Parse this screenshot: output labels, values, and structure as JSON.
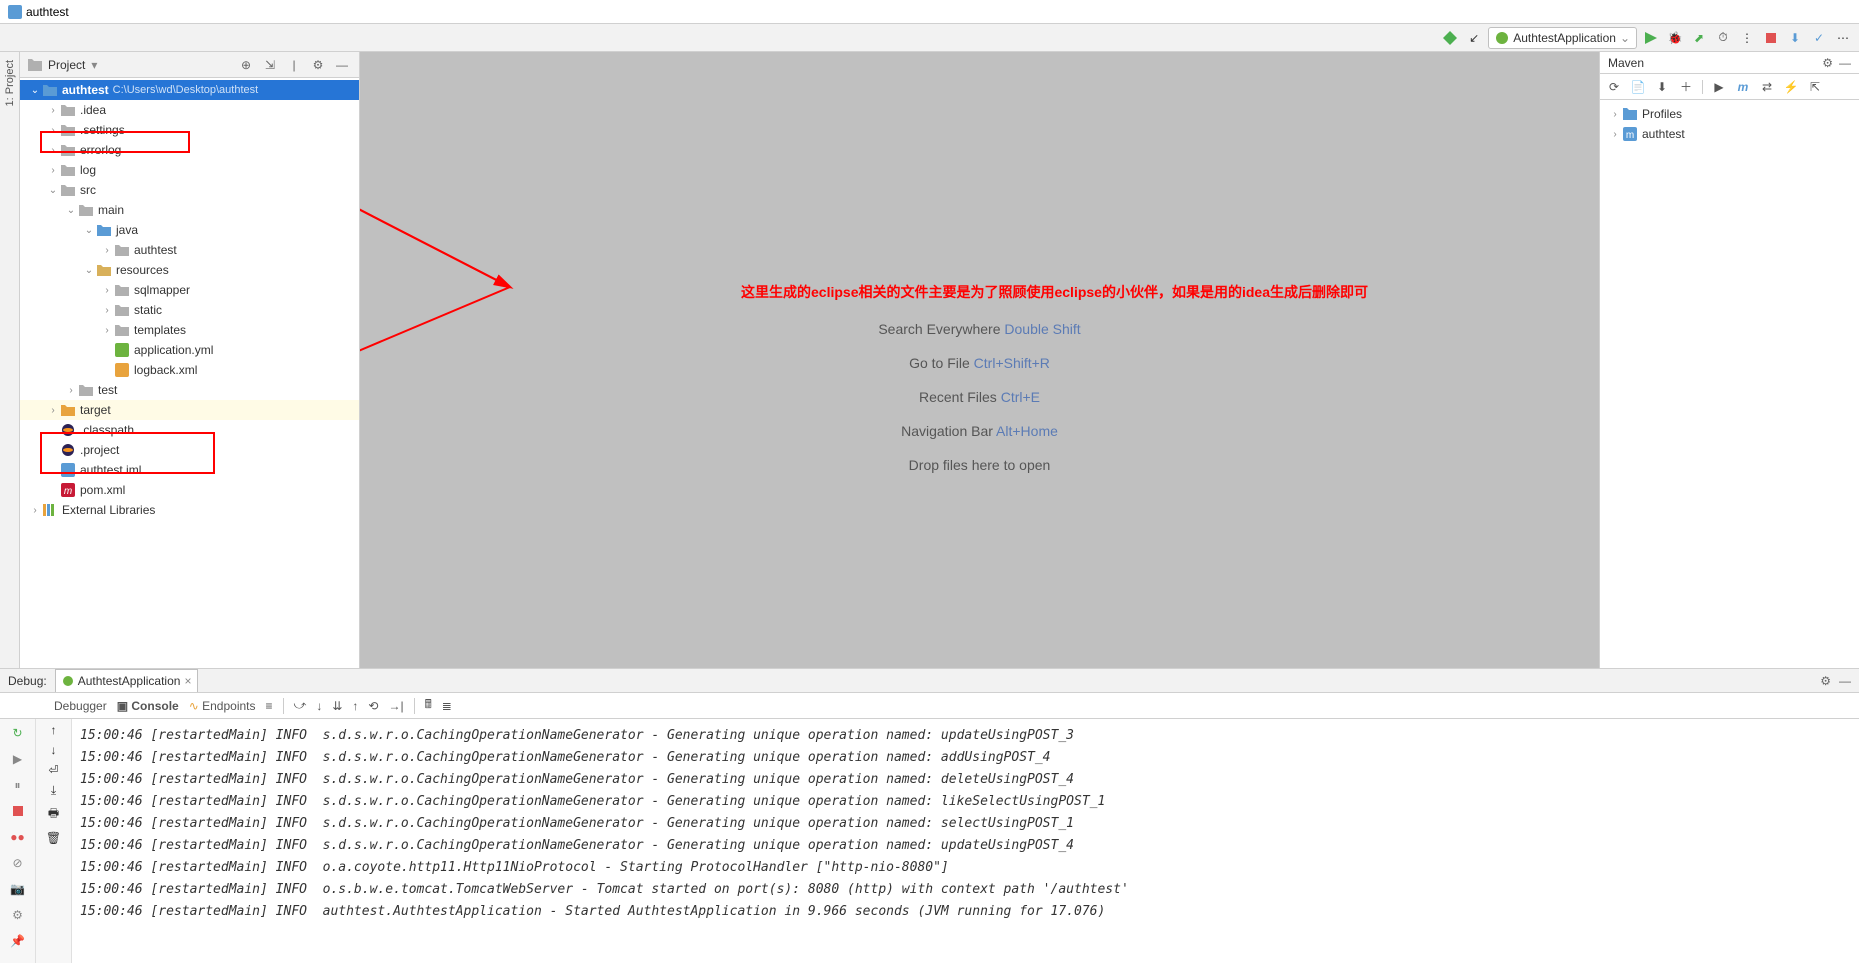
{
  "window": {
    "title": "authtest"
  },
  "runConfig": {
    "label": "AuthtestApplication"
  },
  "projectPanel": {
    "title": "Project"
  },
  "tree": {
    "root": {
      "name": "authtest",
      "path": "C:\\Users\\wd\\Desktop\\authtest"
    },
    "items": [
      {
        "indent": 1,
        "arrow": "›",
        "icon": "folder",
        "label": ".idea"
      },
      {
        "indent": 1,
        "arrow": "›",
        "icon": "folder",
        "label": ".settings"
      },
      {
        "indent": 1,
        "arrow": "›",
        "icon": "folder",
        "label": "errorlog"
      },
      {
        "indent": 1,
        "arrow": "›",
        "icon": "folder",
        "label": "log"
      },
      {
        "indent": 1,
        "arrow": "⌄",
        "icon": "folder",
        "label": "src"
      },
      {
        "indent": 2,
        "arrow": "⌄",
        "icon": "folder",
        "label": "main"
      },
      {
        "indent": 3,
        "arrow": "⌄",
        "icon": "folder-blue",
        "label": "java"
      },
      {
        "indent": 4,
        "arrow": "›",
        "icon": "folder",
        "label": "authtest"
      },
      {
        "indent": 3,
        "arrow": "⌄",
        "icon": "folder-res",
        "label": "resources"
      },
      {
        "indent": 4,
        "arrow": "›",
        "icon": "folder",
        "label": "sqlmapper"
      },
      {
        "indent": 4,
        "arrow": "›",
        "icon": "folder",
        "label": "static"
      },
      {
        "indent": 4,
        "arrow": "›",
        "icon": "folder",
        "label": "templates"
      },
      {
        "indent": 4,
        "arrow": "",
        "icon": "yml",
        "label": "application.yml"
      },
      {
        "indent": 4,
        "arrow": "",
        "icon": "xml",
        "label": "logback.xml"
      },
      {
        "indent": 2,
        "arrow": "›",
        "icon": "folder",
        "label": "test"
      },
      {
        "indent": 1,
        "arrow": "›",
        "icon": "folder-orange",
        "label": "target",
        "highlight": true
      },
      {
        "indent": 1,
        "arrow": "",
        "icon": "eclipse",
        "label": ".classpath"
      },
      {
        "indent": 1,
        "arrow": "",
        "icon": "eclipse",
        "label": ".project"
      },
      {
        "indent": 1,
        "arrow": "",
        "icon": "iml",
        "label": "authtest.iml"
      },
      {
        "indent": 1,
        "arrow": "",
        "icon": "maven",
        "label": "pom.xml"
      },
      {
        "indent": 0,
        "arrow": "›",
        "icon": "lib",
        "label": "External Libraries"
      }
    ]
  },
  "annotation": "这里生成的eclipse相关的文件主要是为了照顾使用eclipse的小伙伴，如果是用的idea生成后删除即可",
  "hints": {
    "searchEverywhere": {
      "label": "Search Everywhere",
      "kbd": "Double Shift"
    },
    "gotoFile": {
      "label": "Go to File",
      "kbd": "Ctrl+Shift+R"
    },
    "recentFiles": {
      "label": "Recent Files",
      "kbd": "Ctrl+E"
    },
    "navBar": {
      "label": "Navigation Bar",
      "kbd": "Alt+Home"
    },
    "dropFiles": {
      "label": "Drop files here to open"
    }
  },
  "maven": {
    "title": "Maven",
    "profiles": "Profiles",
    "project": "authtest"
  },
  "debug": {
    "label": "Debug:",
    "runConfig": "AuthtestApplication",
    "tabs": {
      "debugger": "Debugger",
      "console": "Console",
      "endpoints": "Endpoints"
    },
    "lines": [
      "15:00:46 [restartedMain] INFO  s.d.s.w.r.o.CachingOperationNameGenerator - Generating unique operation named: updateUsingPOST_3",
      "15:00:46 [restartedMain] INFO  s.d.s.w.r.o.CachingOperationNameGenerator - Generating unique operation named: addUsingPOST_4",
      "15:00:46 [restartedMain] INFO  s.d.s.w.r.o.CachingOperationNameGenerator - Generating unique operation named: deleteUsingPOST_4",
      "15:00:46 [restartedMain] INFO  s.d.s.w.r.o.CachingOperationNameGenerator - Generating unique operation named: likeSelectUsingPOST_1",
      "15:00:46 [restartedMain] INFO  s.d.s.w.r.o.CachingOperationNameGenerator - Generating unique operation named: selectUsingPOST_1",
      "15:00:46 [restartedMain] INFO  s.d.s.w.r.o.CachingOperationNameGenerator - Generating unique operation named: updateUsingPOST_4",
      "15:00:46 [restartedMain] INFO  o.a.coyote.http11.Http11NioProtocol - Starting ProtocolHandler [\"http-nio-8080\"]",
      "15:00:46 [restartedMain] INFO  o.s.b.w.e.tomcat.TomcatWebServer - Tomcat started on port(s): 8080 (http) with context path '/authtest'",
      "15:00:46 [restartedMain] INFO  authtest.AuthtestApplication - Started AuthtestApplication in 9.966 seconds (JVM running for 17.076)"
    ]
  }
}
